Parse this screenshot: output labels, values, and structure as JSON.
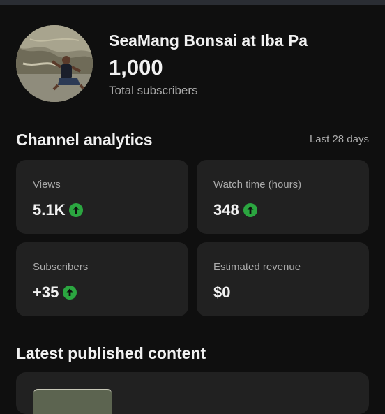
{
  "channel": {
    "name": "SeaMang Bonsai at Iba Pa",
    "subscriber_count": "1,000",
    "subscriber_label": "Total subscribers",
    "avatar_icon": "channel-avatar-photo"
  },
  "analytics": {
    "title": "Channel analytics",
    "range": "Last 28 days",
    "up_color": "#2ba640",
    "cards": [
      {
        "label": "Views",
        "value": "5.1K",
        "trend": "up"
      },
      {
        "label": "Watch time (hours)",
        "value": "348",
        "trend": "up"
      },
      {
        "label": "Subscribers",
        "value": "+35",
        "trend": "up"
      },
      {
        "label": "Estimated revenue",
        "value": "$0",
        "trend": "none"
      }
    ]
  },
  "latest": {
    "title": "Latest published content"
  }
}
